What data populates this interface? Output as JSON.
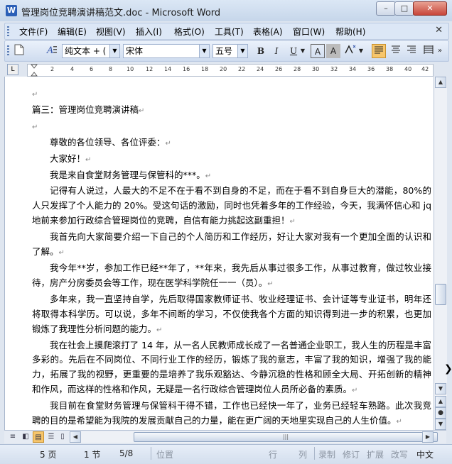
{
  "window": {
    "title": "管理岗位竞聘演讲稿范文.doc - Microsoft Word",
    "app_icon": "W",
    "minimize": "–",
    "maximize": "□",
    "close": "✕"
  },
  "menu": {
    "items": [
      "文件(F)",
      "编辑(E)",
      "视图(V)",
      "插入(I)",
      "格式(O)",
      "工具(T)",
      "表格(A)",
      "窗口(W)",
      "帮助(H)"
    ],
    "close_doc": "✕"
  },
  "toolbar": {
    "style": "纯文本 + (",
    "font": "宋体",
    "size": "五号",
    "bold": "B",
    "italic": "I",
    "underline": "U",
    "char_border": "A",
    "char_shade": "A",
    "highlight": "A"
  },
  "ruler": {
    "ticks": [
      "2",
      "4",
      "6",
      "8",
      "10",
      "12",
      "14",
      "16",
      "18",
      "20",
      "22",
      "24",
      "26",
      "28",
      "30",
      "32",
      "34",
      "36",
      "38",
      "40",
      "42"
    ],
    "corner": "L"
  },
  "document": {
    "paragraphs": [
      {
        "text": "",
        "indent": false
      },
      {
        "text": "篇三：管理岗位竞聘演讲稿",
        "indent": false
      },
      {
        "text": "",
        "indent": false
      },
      {
        "text": "尊敬的各位领导、各位评委：",
        "indent": true
      },
      {
        "text": "大家好！",
        "indent": true
      },
      {
        "text": "我是来自食堂财务管理与保管科的***。",
        "indent": true
      },
      {
        "text": "记得有人说过，人最大的不足不在于看不到自身的不足，而在于看不到自身巨大的潜能，80%的人只发挥了个人能力的 20%。受这句话的激励，同时也凭着多年的工作经验，今天，我满怀信心和 jq 地前来参加行政综合管理岗位的竞聘，自信有能力挑起这副重担！",
        "indent": true
      },
      {
        "text": "我首先向大家简要介绍一下自己的个人简历和工作经历，好让大家对我有一个更加全面的认识和了解。",
        "indent": true
      },
      {
        "text": "我今年**岁，参加工作已经**年了，**年来，我先后从事过很多工作，从事过教育，做过牧业接待，房产分房委员会等工作，现在医学科学院任一一（员）。",
        "indent": true
      },
      {
        "text": "多年来，我一直坚持自学，先后取得国家教师证书、牧业经理证书、会计证等专业证书，明年还将取得本科学历。可以说，多年不间断的学习，不仅使我各个方面的知识得到进一步的积累，也更加锻炼了我理性分析问题的能力。",
        "indent": true
      },
      {
        "text": "我在社会上摸爬滚打了 14 年，从一名人民教师成长成了一名普通企业职工，我人生的历程是丰富多彩的。先后在不同岗位、不同行业工作的经历，锻炼了我的意志，丰富了我的知识，增强了我的能力，拓展了我的视野，更重要的是培养了我乐观豁达、今静沉稳的性格和顾全大局、开拓创新的精神和作风，而这样的性格和作风，无疑是一名行政综合管理岗位人员所必备的素质。",
        "indent": true
      },
      {
        "text": "我目前在食堂财务管理与保管科干得不错，工作也已经快一年了，业务已经轻车熟路。此次我竞聘的目的是希望能为我院的发展贡献自己的力量，能在更广阔的天地里实现自己的人生价值。",
        "indent": true
      }
    ],
    "para_mark": "↵"
  },
  "status": {
    "page": "5 页",
    "section": "1 节",
    "pages": "5/8",
    "position": "位置",
    "line": "行",
    "column": "列",
    "rec": "录制",
    "trk": "修订",
    "ext": "扩展",
    "ovr": "改写",
    "lang": "中文"
  }
}
